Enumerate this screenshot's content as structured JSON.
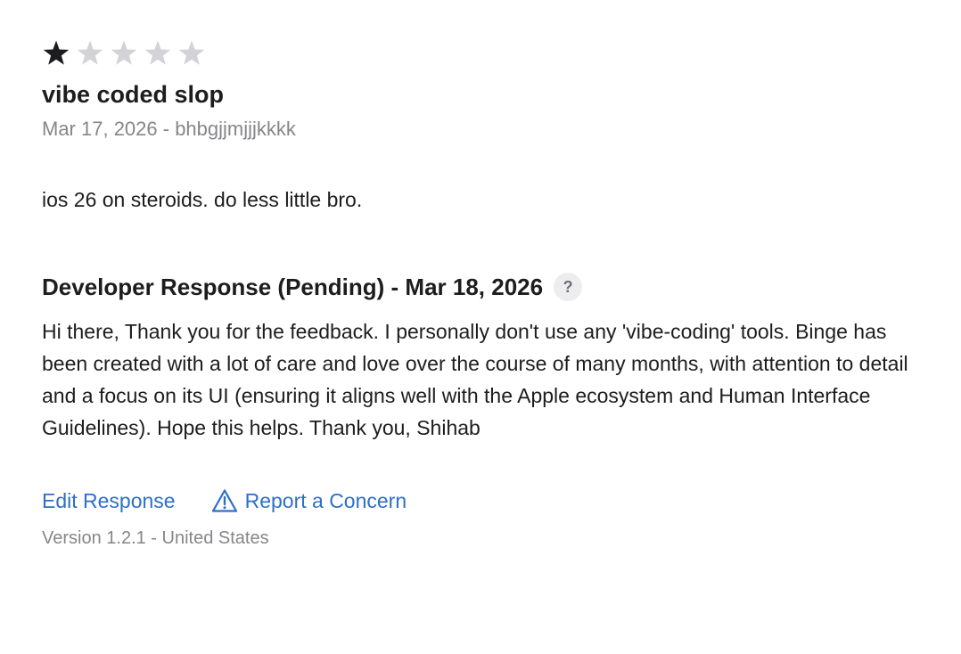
{
  "review": {
    "rating": 1,
    "max_rating": 5,
    "title": "vibe coded slop",
    "meta": "Mar 17, 2026 - bhbgjjmjjjkkkk",
    "body": "ios 26 on steroids. do less little bro."
  },
  "developer_response": {
    "header": "Developer Response (Pending) - Mar 18, 2026",
    "help_label": "?",
    "text": "Hi there, Thank you for the feedback. I personally don't use any 'vibe-coding' tools. Binge has been created with a lot of care and love over the course of many months, with attention to detail and a focus on its UI (ensuring it aligns well with the Apple ecosystem and Human Interface Guidelines). Hope this helps. Thank you, Shihab"
  },
  "actions": {
    "edit_label": "Edit Response",
    "report_label": "Report a Concern",
    "report_icon": "warning-triangle-icon"
  },
  "footer": {
    "version": "Version 1.2.1 - United States"
  },
  "colors": {
    "star_filled": "#1d1d1f",
    "star_empty": "#d2d2d7",
    "link": "#2e6fc7",
    "secondary_text": "#86868b"
  }
}
